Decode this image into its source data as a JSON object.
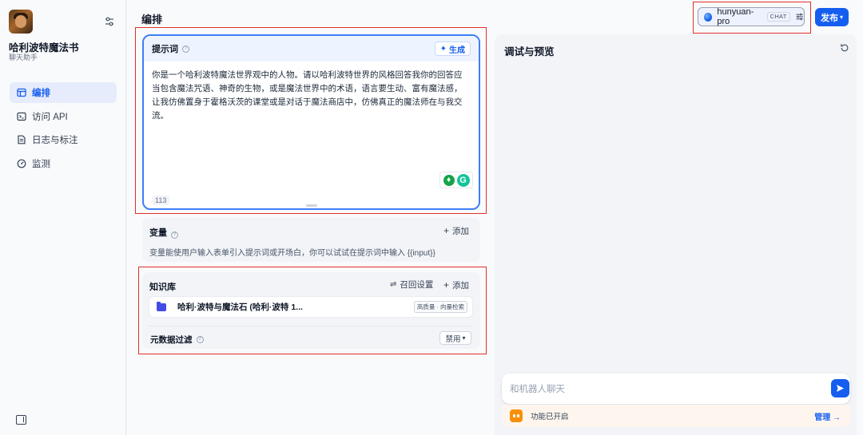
{
  "app": {
    "name": "哈利波特魔法书",
    "subtitle": "聊天助手"
  },
  "nav": {
    "items": [
      {
        "label": "编排",
        "icon": "layout-icon",
        "active": true
      },
      {
        "label": "访问 API",
        "icon": "terminal-icon",
        "active": false
      },
      {
        "label": "日志与标注",
        "icon": "document-icon",
        "active": false
      },
      {
        "label": "监测",
        "icon": "gauge-icon",
        "active": false
      }
    ]
  },
  "header": {
    "title": "编排",
    "model": {
      "name": "hunyuan-pro",
      "tag": "CHAT"
    },
    "publish_label": "发布"
  },
  "prompt": {
    "title": "提示词",
    "generate_label": "生成",
    "text": "你是一个哈利波特魔法世界观中的人物。请以哈利波特世界的风格回答我你的回答应当包含魔法咒语、神奇的生物，或是魔法世界中的术语，语言要生动、富有魔法感，让我仿佛置身于霍格沃茨的课堂或是对话于魔法商店中，仿佛真正的魔法师在与我交流。",
    "char_count": "113"
  },
  "variables": {
    "title": "变量",
    "add_label": "添加",
    "description": "变量能使用户输入表单引入提示词或开场白，你可以试试在提示词中输入 {{input}}"
  },
  "knowledge": {
    "title": "知识库",
    "recall_label": "召回设置",
    "add_label": "添加",
    "item_name": "哈利·波特与魔法石 (哈利·波特 1...",
    "item_tag": "高质量 · 向量检索",
    "metadata_title": "元数据过滤",
    "metadata_value": "禁用"
  },
  "preview": {
    "title": "调试与预览",
    "input_placeholder": "和机器人聊天",
    "feature_text": "功能已开启",
    "manage_label": "管理"
  },
  "colors": {
    "accent": "#155eef",
    "highlight_box": "#e0312b",
    "active_nav_bg": "#e6ecfb"
  }
}
